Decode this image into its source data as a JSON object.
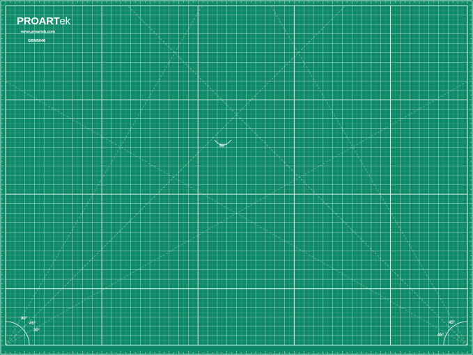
{
  "brand": {
    "logo_main": "PRO",
    "logo_mid": "ART",
    "logo_tail": "ek",
    "website": "www.proartek.com",
    "model": "GBM5048"
  },
  "angles": {
    "center": "90°",
    "bottom_left_a": "90°",
    "bottom_left_b": "45°",
    "bottom_left_c": "30°",
    "bottom_right_a": "45°",
    "bottom_right_b": "45°"
  },
  "colors": {
    "mat_green": "#0f8a68",
    "grid_line": "#d7f0e6",
    "white": "#ffffff"
  },
  "grid": {
    "columns": 48,
    "rows": 36
  }
}
